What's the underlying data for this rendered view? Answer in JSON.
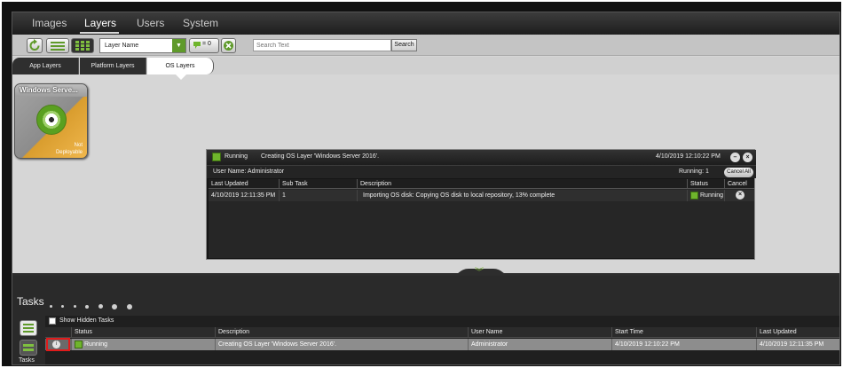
{
  "nav": {
    "tabs": [
      {
        "label": "Images"
      },
      {
        "label": "Layers"
      },
      {
        "label": "Users"
      },
      {
        "label": "System"
      }
    ],
    "active": "Layers"
  },
  "toolbar": {
    "filter_select_value": "Layer Name",
    "filter_count": "= 0",
    "search_placeholder": "Search Text",
    "search_button": "Search"
  },
  "layer_tabs": [
    {
      "label": "App Layers"
    },
    {
      "label": "Platform Layers"
    },
    {
      "label": "OS Layers"
    }
  ],
  "layer_card": {
    "title": "Windows Serve...",
    "status_line1": "Not",
    "status_line2": "Deployable"
  },
  "task_dialog": {
    "status": "Running",
    "message": "Creating OS Layer 'Windows Server 2016'.",
    "timestamp": "4/10/2019 12:10:22 PM",
    "user_label": "User Name: Administrator",
    "running_label": "Running: 1",
    "cancel_all": "Cancel All",
    "columns": [
      "Last Updated",
      "Sub Task",
      "Description",
      "Status",
      "Cancel"
    ],
    "rows": [
      {
        "last_updated": "4/10/2019 12:11:35 PM",
        "sub_task": "1",
        "description": "Importing OS disk: Copying OS disk to local repository, 13% complete",
        "status": "Running"
      }
    ]
  },
  "tasks_panel": {
    "title": "Tasks",
    "side_label": "Tasks",
    "show_hidden_label": "Show Hidden Tasks",
    "columns": [
      "Status",
      "Description",
      "User Name",
      "Start Time",
      "Last Updated"
    ],
    "rows": [
      {
        "status": "Running",
        "description": "Creating OS Layer 'Windows Server 2016'.",
        "user": "Administrator",
        "start_time": "4/10/2019 12:10:22 PM",
        "last_updated": "4/10/2019 12:11:35 PM"
      }
    ]
  },
  "colors": {
    "accent_green": "#6fb52c",
    "highlight_red": "#e01b1b",
    "dark_panel": "#2a2a2a"
  },
  "icons": [
    "refresh-icon",
    "list-view-icon",
    "grid-view-icon",
    "dropdown-arrow-icon",
    "filter-icon",
    "clear-filter-icon",
    "disc-icon",
    "collapse-icon",
    "close-icon",
    "cancel-icon",
    "expand-chevron-icon",
    "info-icon"
  ]
}
